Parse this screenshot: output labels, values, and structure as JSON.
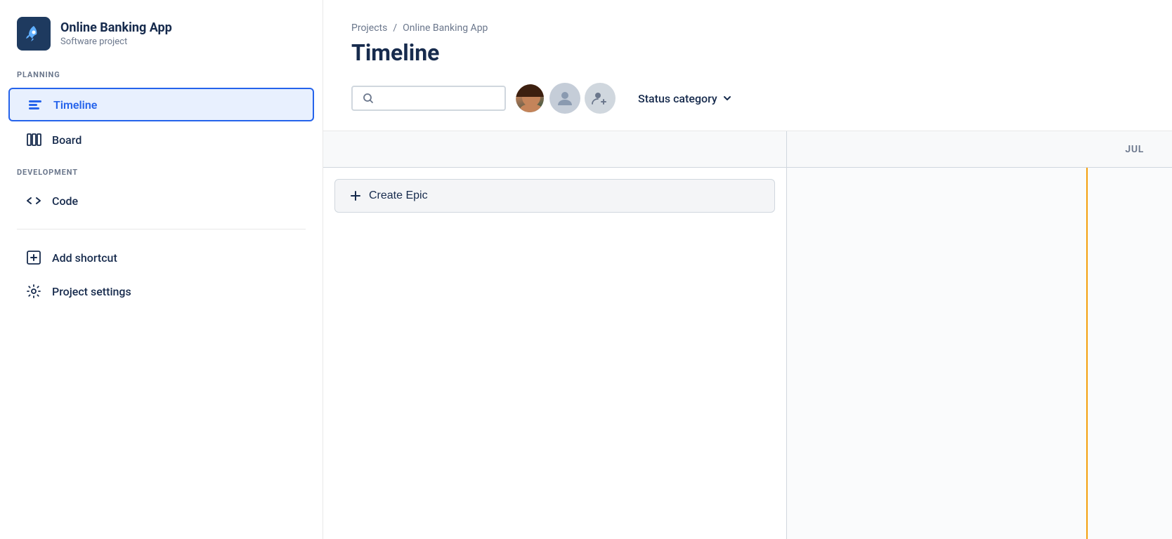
{
  "sidebar": {
    "project": {
      "name": "Online Banking App",
      "type": "Software project"
    },
    "sections": [
      {
        "label": "PLANNING",
        "items": [
          {
            "id": "timeline",
            "label": "Timeline",
            "active": true
          },
          {
            "id": "board",
            "label": "Board",
            "active": false
          }
        ]
      },
      {
        "label": "DEVELOPMENT",
        "items": [
          {
            "id": "code",
            "label": "Code",
            "active": false
          }
        ]
      }
    ],
    "bottom_items": [
      {
        "id": "add-shortcut",
        "label": "Add shortcut"
      },
      {
        "id": "project-settings",
        "label": "Project settings"
      }
    ]
  },
  "main": {
    "breadcrumb": {
      "parts": [
        "Projects",
        "Online Banking App"
      ]
    },
    "title": "Timeline",
    "search": {
      "placeholder": ""
    },
    "status_dropdown": {
      "label": "Status category",
      "chevron": "▾"
    },
    "timeline": {
      "month": "JUL",
      "create_epic_label": "Create Epic"
    }
  }
}
